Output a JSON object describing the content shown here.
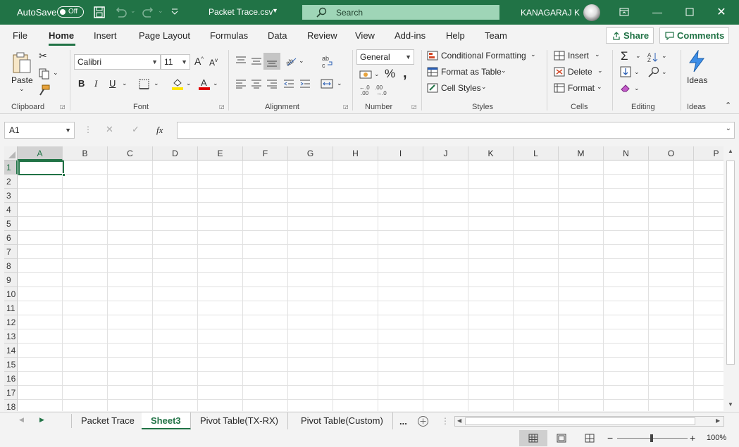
{
  "titlebar": {
    "autosave_label": "AutoSave",
    "autosave_state": "Off",
    "filename": "Packet Trace.csv",
    "search_placeholder": "Search",
    "user": "KANAGARAJ K"
  },
  "tabs": [
    "File",
    "Home",
    "Insert",
    "Page Layout",
    "Formulas",
    "Data",
    "Review",
    "View",
    "Add-ins",
    "Help",
    "Team"
  ],
  "share_label": "Share",
  "comments_label": "Comments",
  "ribbon": {
    "clipboard": {
      "paste": "Paste",
      "label": "Clipboard"
    },
    "font": {
      "name": "Calibri",
      "size": "11",
      "label": "Font",
      "bold": "B",
      "italic": "I",
      "underline": "U"
    },
    "alignment": {
      "label": "Alignment"
    },
    "number": {
      "format": "General",
      "label": "Number"
    },
    "styles": {
      "conditional": "Conditional Formatting",
      "format_table": "Format as Table",
      "cell_styles": "Cell Styles",
      "label": "Styles"
    },
    "cells": {
      "insert": "Insert",
      "delete": "Delete",
      "format": "Format",
      "label": "Cells"
    },
    "editing": {
      "label": "Editing"
    },
    "ideas": {
      "button": "Ideas",
      "label": "Ideas"
    }
  },
  "namebox": "A1",
  "fx": "fx",
  "columns": [
    "A",
    "B",
    "C",
    "D",
    "E",
    "F",
    "G",
    "H",
    "I",
    "J",
    "K",
    "L",
    "M",
    "N",
    "O",
    "P"
  ],
  "rows": [
    "1",
    "2",
    "3",
    "4",
    "5",
    "6",
    "7",
    "8",
    "9",
    "10",
    "11",
    "12",
    "13",
    "14",
    "15",
    "16",
    "17",
    "18"
  ],
  "sheets": [
    "Packet Trace",
    "Sheet3",
    "Pivot Table(TX-RX)",
    "Pivot Table(Custom)"
  ],
  "more_sheets": "...",
  "zoom": "100%",
  "colors": {
    "accent": "#217346",
    "search": "#9fd5b7"
  }
}
